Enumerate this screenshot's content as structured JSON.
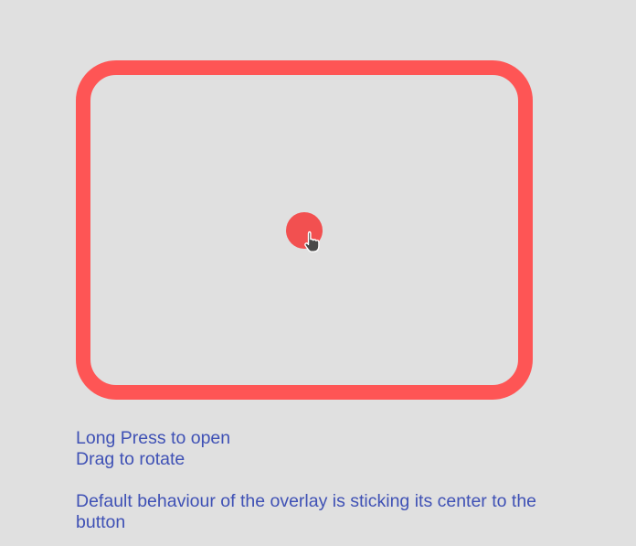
{
  "colors": {
    "background": "#e0e0e0",
    "overlay_frame": "#fe5555",
    "trigger_button": "#f25050",
    "instruction_text": "#3f51b5"
  },
  "icons": {
    "cursor": "hand-pointer-icon"
  },
  "instructions": {
    "line1": "Long Press to open",
    "line2": "Drag to rotate",
    "line3": "Default behaviour of the overlay is sticking its center to the button"
  }
}
